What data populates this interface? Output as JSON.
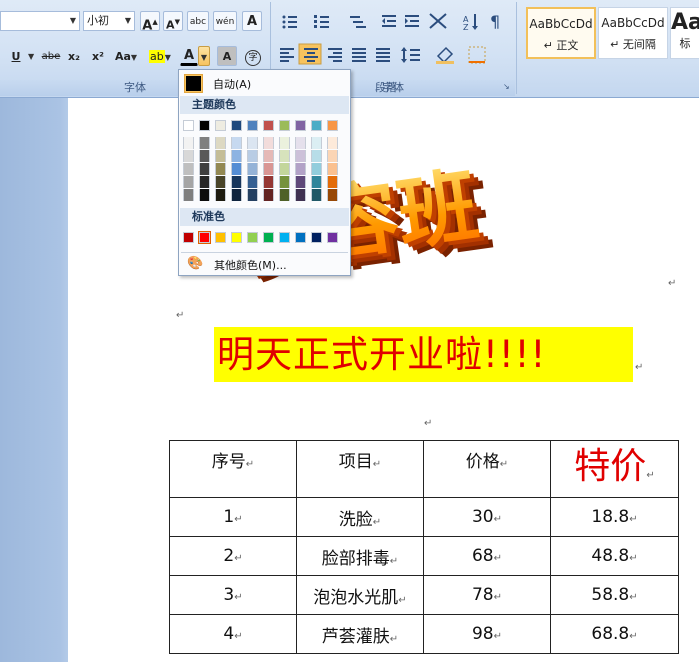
{
  "ribbon": {
    "font_size_value": "小初",
    "group_font_label": "字体",
    "group_paragraph_label": "段落",
    "styles": [
      {
        "sample": "AaBbCcDd",
        "name": "↵ 正文",
        "selected": true
      },
      {
        "sample": "AaBbCcDd",
        "name": "↵ 无间隔",
        "selected": false
      },
      {
        "sample": "Aa",
        "name": "标",
        "selected": false
      }
    ],
    "buttons": {
      "grow_font": "A",
      "shrink_font": "A",
      "phonetic": "abc",
      "wen": "wén",
      "char_border": "A",
      "underline": "U",
      "strike": "abe",
      "subscript": "x₂",
      "superscript": "x²",
      "change_case": "Aa",
      "highlight": "ab",
      "font_color": "A",
      "char_shade": "A",
      "enclose": "字"
    }
  },
  "color_menu": {
    "auto_label": "自动(A)",
    "theme_header": "主题颜色",
    "standard_header": "标准色",
    "more_label": "其他颜色(M)...",
    "theme_base": [
      "#ffffff",
      "#000000",
      "#eeece1",
      "#1f497d",
      "#4f81bd",
      "#c0504d",
      "#9bbb59",
      "#8064a2",
      "#4bacc6",
      "#f79646"
    ],
    "theme_tints": [
      [
        "#f2f2f2",
        "#d8d8d8",
        "#bfbfbf",
        "#a5a5a5",
        "#7f7f7f"
      ],
      [
        "#7f7f7f",
        "#595959",
        "#3f3f3f",
        "#262626",
        "#0c0c0c"
      ],
      [
        "#ddd9c3",
        "#c4bd97",
        "#938953",
        "#494429",
        "#1d1b10"
      ],
      [
        "#c6d9f0",
        "#8db3e2",
        "#548dd4",
        "#17365d",
        "#0f243e"
      ],
      [
        "#dbe5f1",
        "#b8cce4",
        "#95b3d7",
        "#366092",
        "#244061"
      ],
      [
        "#f2dcdb",
        "#e5b9b7",
        "#d99694",
        "#953734",
        "#632423"
      ],
      [
        "#ebf1dd",
        "#d7e3bc",
        "#c3d69b",
        "#76923c",
        "#4f6128"
      ],
      [
        "#e5e0ec",
        "#ccc1d9",
        "#b2a2c7",
        "#5f497a",
        "#3f3151"
      ],
      [
        "#dbeef3",
        "#b7dde8",
        "#92cddc",
        "#31859b",
        "#205867"
      ],
      [
        "#fdeada",
        "#fbd5b5",
        "#fac08f",
        "#e36c09",
        "#974806"
      ]
    ],
    "standard": [
      "#c00000",
      "#ff0000",
      "#ffc000",
      "#ffff00",
      "#92d050",
      "#00b050",
      "#00b0f0",
      "#0070c0",
      "#002060",
      "#7030a0"
    ]
  },
  "document": {
    "wordart_text": "美容班",
    "banner_text": "明天正式开业啦!!!!",
    "table": {
      "headers": [
        "序号",
        "项目",
        "价格",
        "特价"
      ],
      "rows": [
        [
          "1",
          "洗脸",
          "30",
          "18.8"
        ],
        [
          "2",
          "脸部排毒",
          "68",
          "48.8"
        ],
        [
          "3",
          "泡泡水光肌",
          "78",
          "58.8"
        ],
        [
          "4",
          "芦荟灌肤",
          "98",
          "68.8"
        ]
      ]
    },
    "paragraph_mark": "↵"
  },
  "colors": {
    "banner_bg": "#ffff00",
    "banner_text": "#e00000",
    "wordart_front": "#ff8c00",
    "wordart_side": "#a03000",
    "ribbon_bg": "#d3e2f4"
  }
}
